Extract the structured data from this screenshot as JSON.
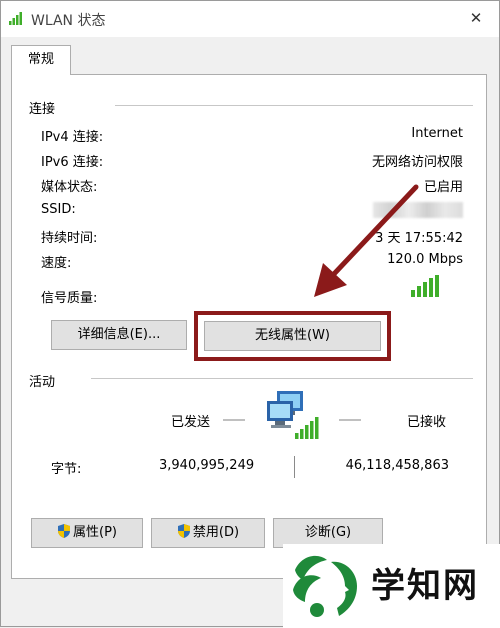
{
  "window": {
    "title": "WLAN 状态",
    "close_glyph": "✕"
  },
  "tabs": [
    {
      "label": "常规"
    }
  ],
  "connection": {
    "title": "连接",
    "rows": [
      {
        "label": "IPv4 连接:",
        "value": "Internet"
      },
      {
        "label": "IPv6 连接:",
        "value": "无网络访问权限"
      },
      {
        "label": "媒体状态:",
        "value": "已启用"
      },
      {
        "label": "SSID:",
        "value": ""
      },
      {
        "label": "持续时间:",
        "value": "3 天 17:55:42"
      },
      {
        "label": "速度:",
        "value": "120.0 Mbps"
      },
      {
        "label": "信号质量:",
        "value": ""
      }
    ],
    "details_button": "详细信息(E)...",
    "wireless_props_button": "无线属性(W)"
  },
  "activity": {
    "title": "活动",
    "sent_label": "已发送",
    "received_label": "已接收",
    "bytes_label": "字节:",
    "bytes_sent": "3,940,995,249",
    "bytes_received": "46,118,458,863"
  },
  "bottom_buttons": {
    "properties": "属性(P)",
    "disable": "禁用(D)",
    "diagnose": "诊断(G)"
  },
  "watermark": {
    "text": "学知网"
  },
  "icons": {
    "title": "wifi-signal-icon",
    "signal": "signal-bars-icon",
    "network": "network-computers-icon",
    "shield": "uac-shield-icon"
  },
  "colors": {
    "annotation": "#8b1a1a",
    "signal_green": "#3fae2a",
    "watermark_green": "#1f8a3a"
  }
}
